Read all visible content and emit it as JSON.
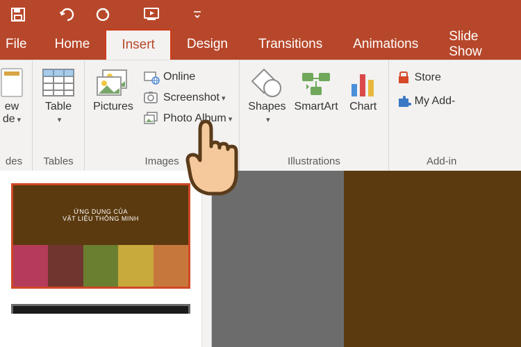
{
  "qat": {
    "more_label": "More"
  },
  "tabs": {
    "file": "File",
    "home": "Home",
    "insert": "Insert",
    "design": "Design",
    "transitions": "Transitions",
    "animations": "Animations",
    "slideshow": "Slide Show"
  },
  "ribbon": {
    "slides": {
      "new_slide": "ew\nde",
      "group_label": "des"
    },
    "tables": {
      "table": "Table",
      "group_label": "Tables"
    },
    "images": {
      "pictures": "Pictures",
      "online": "Online",
      "screenshot": "Screenshot",
      "photo_album": "Photo Album",
      "group_label": "Images"
    },
    "illustrations": {
      "shapes": "Shapes",
      "smartart": "SmartArt",
      "chart": "Chart",
      "group_label": "Illustrations"
    },
    "addins": {
      "store": "Store",
      "my_addins": "My Add-",
      "group_label": "Add-in"
    }
  },
  "thumbnail": {
    "line1": "ỨNG DỤNG CỦA",
    "line2": "VẬT LIỆU THÔNG MINH",
    "stripe_colors": [
      "#b43b5a",
      "#71352f",
      "#6a7f2f",
      "#c8a93b",
      "#c6783c"
    ]
  },
  "colors": {
    "brand": "#b7472a",
    "ribbon_bg": "#f3f2f1",
    "slide_bg": "#5b3a0f"
  }
}
